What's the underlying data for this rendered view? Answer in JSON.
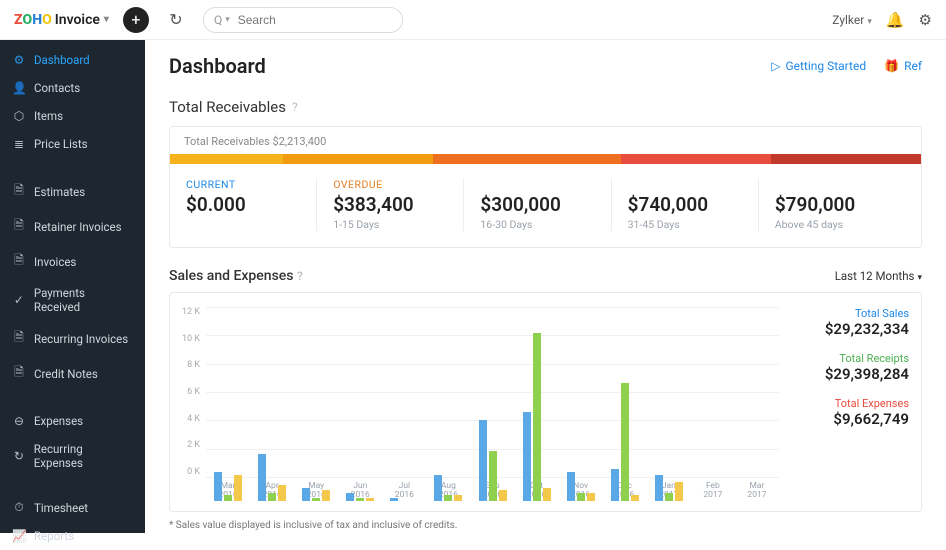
{
  "top": {
    "logo_product": "Invoice",
    "search_placeholder": "Search",
    "org_name": "Zylker",
    "getting_started": "Getting Started",
    "refer": "Ref"
  },
  "sidebar": {
    "items": [
      {
        "icon": "⚙",
        "label": "Dashboard",
        "active": true
      },
      {
        "icon": "👤",
        "label": "Contacts"
      },
      {
        "icon": "⬡",
        "label": "Items"
      },
      {
        "icon": "≣",
        "label": "Price Lists"
      }
    ],
    "group2": [
      {
        "icon": "🗎",
        "label": "Estimates"
      },
      {
        "icon": "🗎",
        "label": "Retainer Invoices"
      },
      {
        "icon": "🗎",
        "label": "Invoices"
      },
      {
        "icon": "✓",
        "label": "Payments Received"
      },
      {
        "icon": "🗎",
        "label": "Recurring Invoices"
      },
      {
        "icon": "🗎",
        "label": "Credit Notes"
      }
    ],
    "group3": [
      {
        "icon": "⊖",
        "label": "Expenses"
      },
      {
        "icon": "↻",
        "label": "Recurring Expenses"
      }
    ],
    "group4": [
      {
        "icon": "⏱",
        "label": "Timesheet"
      },
      {
        "icon": "📈",
        "label": "Reports"
      }
    ]
  },
  "page_title": "Dashboard",
  "receivables": {
    "title": "Total Receivables",
    "subtitle_prefix": "Total Receivables ",
    "subtitle_value": "$2,213,400",
    "buckets": [
      {
        "label": "CURRENT",
        "value": "$0.000",
        "sub": "",
        "cls": "cur"
      },
      {
        "label": "OVERDUE",
        "value": "$383,400",
        "sub": "1-15 Days",
        "cls": "ovd"
      },
      {
        "label": "",
        "value": "$300,000",
        "sub": "16-30 Days",
        "cls": ""
      },
      {
        "label": "",
        "value": "$740,000",
        "sub": "31-45 Days",
        "cls": ""
      },
      {
        "label": "",
        "value": "$790,000",
        "sub": "Above 45 days",
        "cls": ""
      }
    ]
  },
  "sales_expenses": {
    "title": "Sales and Expenses",
    "range_label": "Last 12 Months",
    "footnote": "* Sales value displayed is inclusive of tax and inclusive of credits.",
    "totals": {
      "sales_label": "Total Sales",
      "sales": "$29,232,334",
      "receipts_label": "Total Receipts",
      "receipts": "$29,398,284",
      "expenses_label": "Total Expenses",
      "expenses": "$9,662,749"
    }
  },
  "chart_data": {
    "type": "bar",
    "ylabel": "",
    "ylim": [
      0,
      13
    ],
    "yticks": [
      "12 K",
      "10 K",
      "8 K",
      "6 K",
      "4 K",
      "2 K",
      "0 K"
    ],
    "categories": [
      {
        "m": "Mar",
        "y": "2016"
      },
      {
        "m": "Apr",
        "y": "2016"
      },
      {
        "m": "May",
        "y": "2016"
      },
      {
        "m": "Jun",
        "y": "2016"
      },
      {
        "m": "Jul",
        "y": "2016"
      },
      {
        "m": "Aug",
        "y": "2016"
      },
      {
        "m": "Sep",
        "y": "2016"
      },
      {
        "m": "Oct",
        "y": "2016"
      },
      {
        "m": "Nov",
        "y": "2016"
      },
      {
        "m": "Dec",
        "y": "2016"
      },
      {
        "m": "Jan",
        "y": "2017"
      },
      {
        "m": "Feb",
        "y": "2017"
      },
      {
        "m": "Mar",
        "y": "2017"
      }
    ],
    "series": [
      {
        "name": "Sales",
        "cls": "s",
        "values": [
          2.2,
          3.6,
          1.0,
          0.6,
          0.2,
          2.0,
          6.2,
          6.8,
          2.2,
          2.4,
          2.0,
          0,
          0
        ]
      },
      {
        "name": "Receipts",
        "cls": "r",
        "values": [
          0.4,
          0.6,
          0.2,
          0.2,
          0.0,
          0.4,
          3.8,
          12.8,
          0.6,
          9.0,
          0.6,
          0,
          0
        ]
      },
      {
        "name": "Expenses",
        "cls": "e",
        "values": [
          2.0,
          1.2,
          0.8,
          0.2,
          0.0,
          0.4,
          0.8,
          1.0,
          0.6,
          0.4,
          1.4,
          0,
          0
        ]
      }
    ]
  }
}
